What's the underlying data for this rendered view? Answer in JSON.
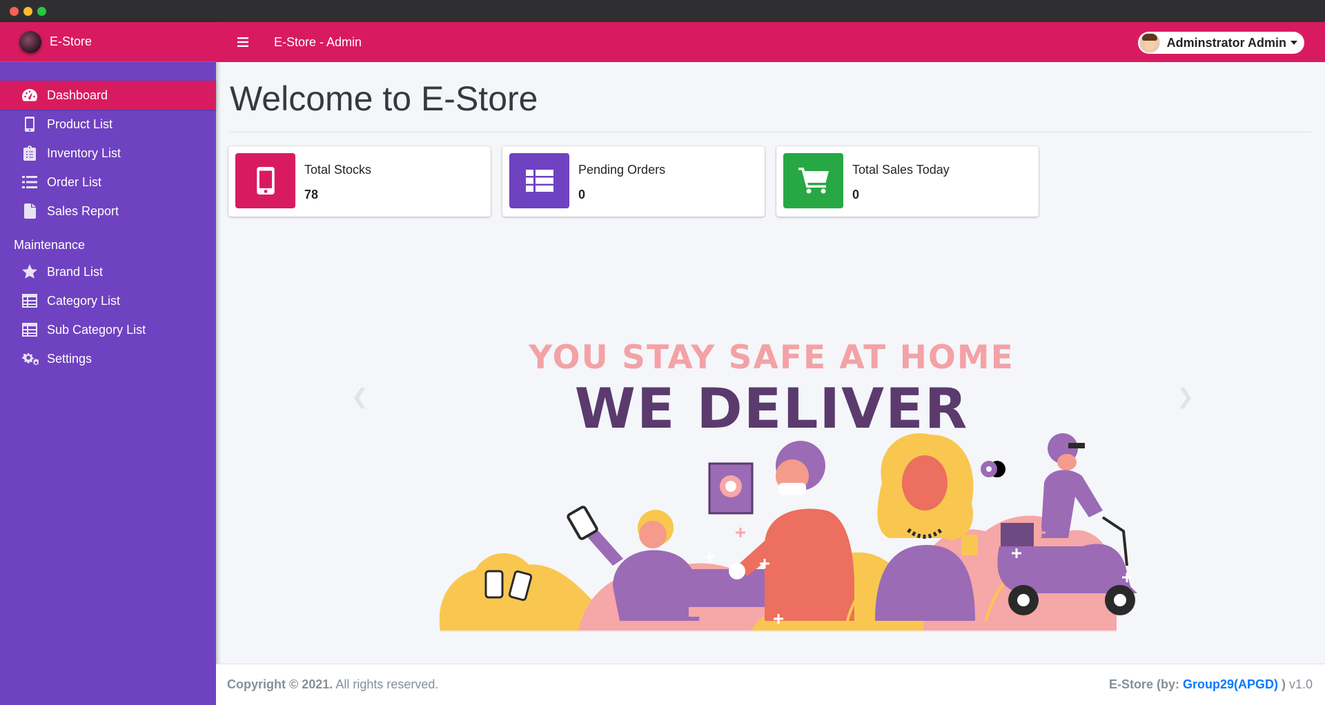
{
  "brand": {
    "name": "E-Store"
  },
  "topbar": {
    "title": "E-Store - Admin",
    "user": "Adminstrator Admin"
  },
  "sidebar": {
    "items": [
      {
        "label": "Dashboard",
        "icon": "tachometer-icon",
        "active": true
      },
      {
        "label": "Product List",
        "icon": "mobile-icon"
      },
      {
        "label": "Inventory List",
        "icon": "clipboard-list-icon"
      },
      {
        "label": "Order List",
        "icon": "list-icon"
      },
      {
        "label": "Sales Report",
        "icon": "file-icon"
      }
    ],
    "section_header": "Maintenance",
    "maintenance": [
      {
        "label": "Brand List",
        "icon": "star-icon"
      },
      {
        "label": "Category List",
        "icon": "table-icon"
      },
      {
        "label": "Sub Category List",
        "icon": "table-icon"
      },
      {
        "label": "Settings",
        "icon": "cogs-icon"
      }
    ]
  },
  "main": {
    "title": "Welcome to E-Store",
    "cards": [
      {
        "label": "Total Stocks",
        "value": "78",
        "color": "#d81b60",
        "icon": "mobile-icon"
      },
      {
        "label": "Pending Orders",
        "value": "0",
        "color": "#6f42c1",
        "icon": "th-list-icon"
      },
      {
        "label": "Total Sales Today",
        "value": "0",
        "color": "#28a745",
        "icon": "shopping-cart-icon"
      }
    ],
    "banner": {
      "line1": "YOU STAY SAFE AT HOME",
      "line2": "WE DELIVER"
    }
  },
  "footer": {
    "copyright_bold": "Copyright © 2021.",
    "copyright_rest": " All rights reserved.",
    "right_prefix": "E-Store (by: ",
    "right_link": "Group29(APGD)",
    "right_suffix": " )",
    "version": " v1.0"
  },
  "colors": {
    "accent": "#d81b60",
    "sidebar": "#6f42c1",
    "success": "#28a745"
  }
}
